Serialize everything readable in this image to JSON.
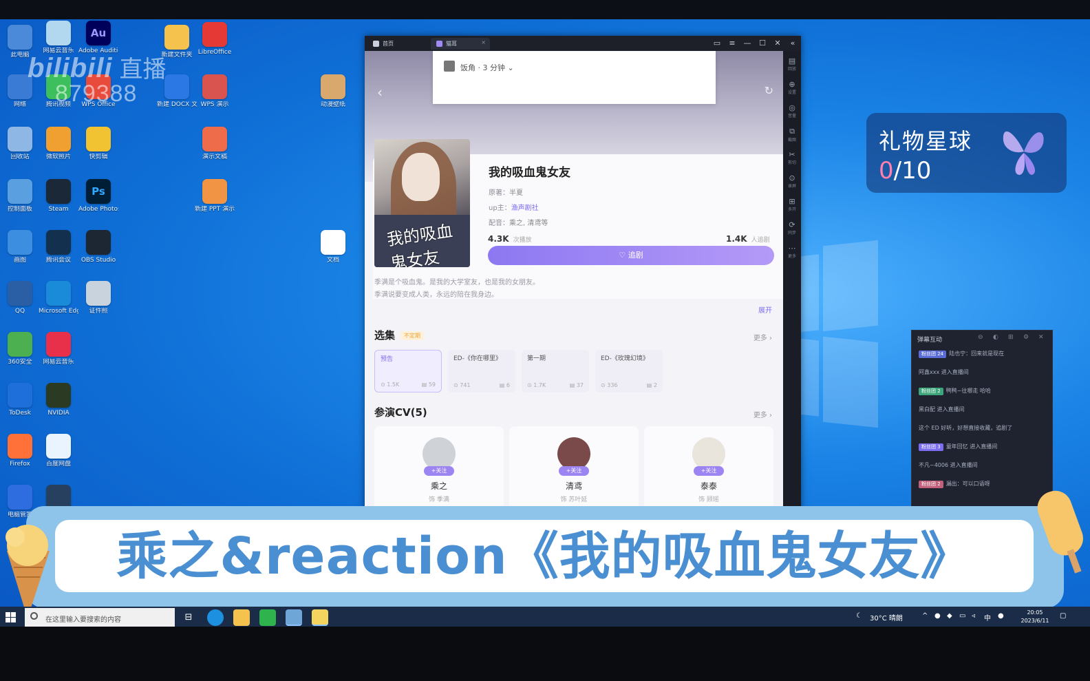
{
  "watermark": {
    "brand": "bilibili",
    "live": "直播",
    "room_id": "879388"
  },
  "desktop_icons": [
    {
      "label": "此电脑",
      "glyph": "",
      "color": "#4b8ad8"
    },
    {
      "label": "网易云音乐",
      "glyph": "",
      "color": "#b2d8f0"
    },
    {
      "label": "Adobe Audition",
      "glyph": "Au",
      "color": "#00005b"
    },
    {
      "label": "新建文件夹",
      "glyph": "",
      "color": "#f4c24d"
    },
    {
      "label": "LibreOffice",
      "glyph": "",
      "color": "#e53935"
    },
    {
      "label": "网络",
      "glyph": "",
      "color": "#3a7bd5"
    },
    {
      "label": "腾讯视频",
      "glyph": "",
      "color": "#3cbf5c"
    },
    {
      "label": "WPS Office",
      "glyph": "",
      "color": "#e84a3c"
    },
    {
      "label": "新建 DOCX 文档",
      "glyph": "",
      "color": "#2b78e4"
    },
    {
      "label": "WPS 演示",
      "glyph": "",
      "color": "#d9534f"
    },
    {
      "label": "回收站",
      "glyph": "",
      "color": "#8fb7e6"
    },
    {
      "label": "微软照片",
      "glyph": "",
      "color": "#f0a030"
    },
    {
      "label": "快剪辑",
      "glyph": "",
      "color": "#f1c232"
    },
    {
      "label": "演示文稿",
      "glyph": "",
      "color": "#ef6c4a"
    },
    {
      "label": "控制面板",
      "glyph": "",
      "color": "#5aa0e0"
    },
    {
      "label": "Steam",
      "glyph": "",
      "color": "#1b2838"
    },
    {
      "label": "Adobe Photoshop",
      "glyph": "Ps",
      "color": "#001e36"
    },
    {
      "label": "新建 PPT 演示文稿",
      "glyph": "",
      "color": "#f19545"
    },
    {
      "label": "画图",
      "glyph": "",
      "color": "#3b8ee0"
    },
    {
      "label": "腾讯会议",
      "glyph": "",
      "color": "#14304f"
    },
    {
      "label": "OBS Studio",
      "glyph": "",
      "color": "#1d2633"
    },
    {
      "label": "QQ",
      "glyph": "",
      "color": "#2b5fa5"
    },
    {
      "label": "Microsoft Edge",
      "glyph": "",
      "color": "#1a8bd8"
    },
    {
      "label": "证件照",
      "glyph": "",
      "color": "#c9d3dd"
    },
    {
      "label": "360安全",
      "glyph": "",
      "color": "#4caf50"
    },
    {
      "label": "网易云音乐",
      "glyph": "",
      "color": "#e8304a"
    },
    {
      "label": "ToDesk",
      "glyph": "",
      "color": "#1e6fd9"
    },
    {
      "label": "NVIDIA",
      "glyph": "",
      "color": "#2a3a23"
    },
    {
      "label": "Firefox",
      "glyph": "",
      "color": "#ff7139"
    },
    {
      "label": "百度网盘",
      "glyph": "",
      "color": "#eaf4ff"
    },
    {
      "label": "电脑管家",
      "glyph": "",
      "color": "#2d6de0"
    },
    {
      "label": "剪映",
      "glyph": "",
      "color": "#28405f"
    },
    {
      "label": "动漫壁纸",
      "glyph": "",
      "color": "#d9a86c"
    },
    {
      "label": "文档",
      "glyph": "",
      "color": "#ffffff"
    }
  ],
  "app_window": {
    "tabs": [
      {
        "label": "首页"
      },
      {
        "label": "猫耳"
      }
    ],
    "window_controls": [
      "▭",
      "≡",
      "—",
      "☐",
      "✕",
      "«"
    ],
    "side_tools": [
      "回放",
      "设置",
      "音量",
      "截图",
      "剪切",
      "录屏",
      "多开",
      "同步",
      "更多"
    ],
    "popup_text": "饭角 · 3 分钟 ⌄",
    "drama": {
      "title": "我的吸血鬼女友",
      "cover_text": "我的吸血鬼女友",
      "author_label": "原著：",
      "author": "半夏",
      "up_label": "up主：",
      "up": "渔声剧社",
      "cv_label": "配音：",
      "cv": "乘之, 清鸢等",
      "plays": "4.3K",
      "plays_label": "次播放",
      "fans": "1.4K",
      "fans_label": "人追剧",
      "follow_label": "追剧",
      "follow_icon": "heart-icon",
      "description": "季满是个吸血鬼。是我的大学室友，也是我的女朋友。\n季满说要变成人类，永远的陪在我身边。",
      "expand": "展开"
    },
    "episodes_section": {
      "title": "选集",
      "badge": "不定期",
      "more": "更多 ›",
      "episodes": [
        {
          "name": "预告",
          "plays": "⊙ 1.5K",
          "comments": "▤ 59",
          "active": true
        },
        {
          "name": "ED-《你在哪里》",
          "plays": "⊙ 741",
          "comments": "▤ 6",
          "active": false
        },
        {
          "name": "第一期",
          "plays": "⊙ 1.7K",
          "comments": "▤ 37",
          "active": false
        },
        {
          "name": "ED-《玫瑰幻境》",
          "plays": "⊙ 336",
          "comments": "▤ 2",
          "active": false
        }
      ]
    },
    "cv_section": {
      "title": "参演CV(5)",
      "more": "更多 ›",
      "cvs": [
        {
          "name": "乘之",
          "role": "饰 季满",
          "follow": "+关注"
        },
        {
          "name": "清鸢",
          "role": "饰 苏叶延",
          "follow": "+关注"
        },
        {
          "name": "泰泰",
          "role": "饰 顾瑶",
          "follow": "+关注"
        }
      ]
    }
  },
  "gift_planet": {
    "title": "礼物星球",
    "count": "0",
    "total": "/10"
  },
  "danmaku": {
    "title": "弹幕互动",
    "controls": [
      "⊖",
      "◐",
      "⊞",
      "⚙",
      "✕"
    ],
    "rows": [
      {
        "tag": "粉丝团 24",
        "tag_color": "#5a6bd6",
        "text": "陆也宁：回来就是现在"
      },
      {
        "tag": "",
        "tag_color": "#000000",
        "text": "阿鑫xxx 进入直播间"
      },
      {
        "tag": "粉丝团 2",
        "tag_color": "#3ca67a",
        "text": "鸭鸭~往哪走 哈哈"
      },
      {
        "tag": "",
        "tag_color": "#000000",
        "text": "黑白配 进入直播间"
      },
      {
        "tag": "",
        "tag_color": "#000000",
        "text": "这个 ED 好听，好想直接收藏，追剧了"
      },
      {
        "tag": "粉丝团 3",
        "tag_color": "#7b6cf0",
        "text": "童年回忆 进入直播间"
      },
      {
        "tag": "",
        "tag_color": "#000000",
        "text": "不凡~4006 进入直播间"
      },
      {
        "tag": "粉丝团 2",
        "tag_color": "#c0607a",
        "text": "漏出：可以口语呀"
      }
    ]
  },
  "banner": {
    "title": "乘之&reaction《我的吸血鬼女友》"
  },
  "taskbar": {
    "search_placeholder": "在这里输入要搜索的内容",
    "weather": "30°C 晴朗",
    "ime": "中",
    "time": "20:05",
    "date": "2023/6/11"
  }
}
